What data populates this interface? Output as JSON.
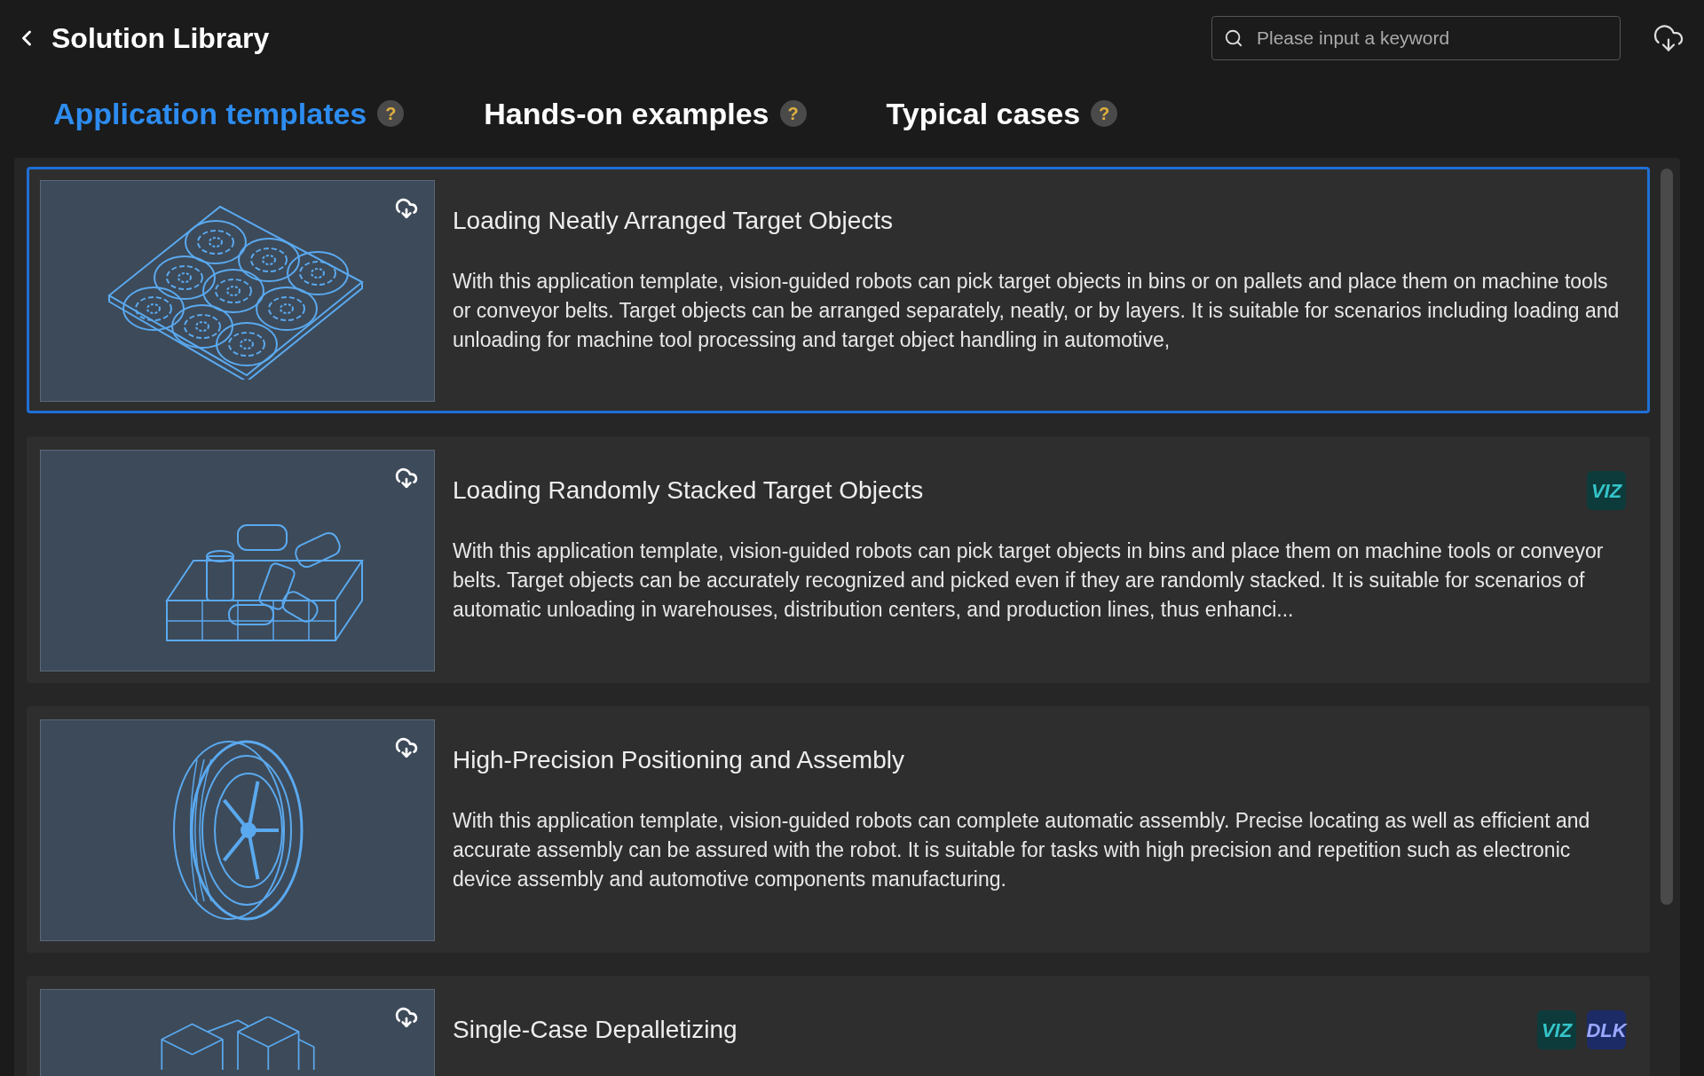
{
  "header": {
    "title": "Solution Library"
  },
  "search": {
    "placeholder": "Please input a keyword"
  },
  "tabs": [
    {
      "label": "Application templates",
      "help": "?",
      "selected": true
    },
    {
      "label": "Hands-on examples",
      "help": "?",
      "selected": false
    },
    {
      "label": "Typical cases",
      "help": "?",
      "selected": false
    }
  ],
  "cards": [
    {
      "title": "Loading Neatly Arranged Target Objects",
      "selected": true,
      "description": "With this application template, vision-guided robots can pick target objects in bins or on pallets and place them on machine tools or conveyor belts. Target objects can be arranged separately, neatly, or by layers. It is suitable for scenarios including loading and unloading for machine tool processing and target object handling in automotive,"
    },
    {
      "title": "Loading Randomly Stacked Target Objects",
      "selected": false,
      "badges": [
        {
          "kind": "viz",
          "label": "VIZ"
        }
      ],
      "description": "With this application template, vision-guided robots can pick target objects in bins and place them on machine tools or conveyor belts. Target objects can be accurately recognized and picked even if they are randomly stacked. It is suitable for scenarios of automatic unloading in warehouses, distribution centers, and production lines, thus enhanci..."
    },
    {
      "title": "High-Precision Positioning and Assembly",
      "selected": false,
      "description": "With this application template, vision-guided robots can complete automatic assembly. Precise locating as well as efficient and accurate assembly can be assured with the robot. It is suitable for tasks with high precision and repetition such as electronic device assembly and automotive components manufacturing."
    },
    {
      "title": "Single-Case Depalletizing",
      "selected": false,
      "badges": [
        {
          "kind": "viz",
          "label": "VIZ"
        },
        {
          "kind": "dlk",
          "label": "DLK"
        }
      ]
    }
  ]
}
